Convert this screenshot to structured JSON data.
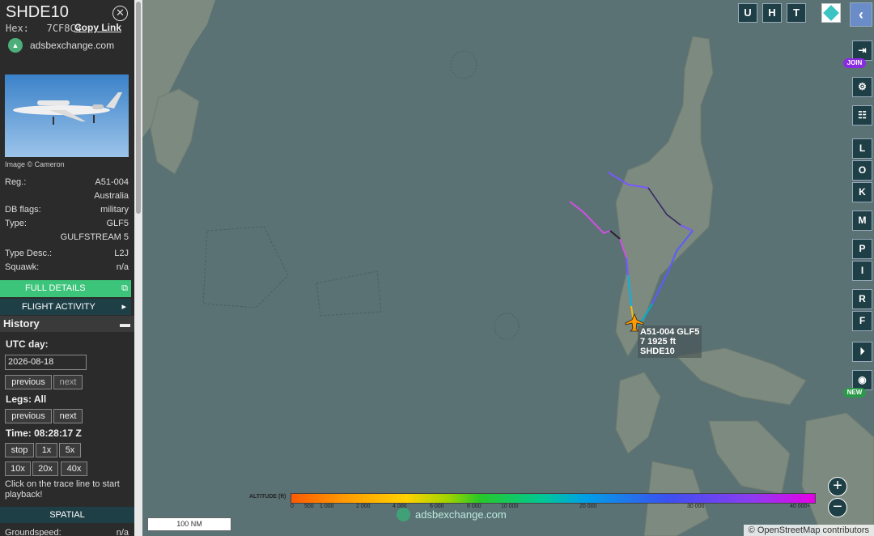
{
  "aircraft": {
    "callsign": "SHDE10",
    "hex_label": "Hex:",
    "hex": "7CF8C4",
    "copy_link": "Copy Link",
    "source": "adsbexchange.com",
    "photo_credit": "Image © Cameron",
    "details": [
      {
        "label": "Reg.:",
        "value": "A51-004"
      },
      {
        "label": "",
        "value": "Australia"
      },
      {
        "label": "DB flags:",
        "value": "military"
      },
      {
        "label": "Type:",
        "value": "GLF5"
      },
      {
        "label": "",
        "value": "GULFSTREAM 5"
      },
      {
        "label": "Type Desc.:",
        "value": "L2J"
      },
      {
        "label": "Squawk:",
        "value": "n/a"
      }
    ],
    "full_details": "FULL DETAILS",
    "flight_activity": "FLIGHT ACTIVITY"
  },
  "history": {
    "title": "History",
    "utc_label": "UTC day:",
    "date": "2026-08-18",
    "previous": "previous",
    "next": "next",
    "legs_label": "Legs: All",
    "time_label": "Time: 08:28:17 Z",
    "stop": "stop",
    "speeds": [
      "1x",
      "5x",
      "10x",
      "20x",
      "40x"
    ],
    "note": "Click on the trace line to start playback!",
    "spatial": "SPATIAL",
    "groundspeed_label": "Groundspeed:",
    "groundspeed_value": "n/a"
  },
  "map": {
    "top_buttons": [
      "U",
      "H",
      "T"
    ],
    "right_buttons": [
      "L",
      "O",
      "K",
      "M",
      "P",
      "I",
      "R",
      "F"
    ],
    "join_badge": "JOIN",
    "new_badge": "NEW",
    "scale": "100 NM",
    "watermark": "adsbexchange.com",
    "attribution": "© OpenStreetMap contributors",
    "aircraft_label": [
      "A51-004 GLF5",
      "7 1925 ft",
      "SHDE10"
    ],
    "zoom_in": "+",
    "zoom_out": "−"
  },
  "altitude_legend": {
    "label": "ALTITUDE (ft)",
    "ticks": [
      "0",
      "500",
      "1 000",
      "2 000",
      "4 000",
      "6 000",
      "8 000",
      "10 000",
      "20 000",
      "30 000",
      "40 000+"
    ]
  },
  "colors": {
    "sidebar_bg": "#2b2b2b",
    "accent_green": "#3cc47a",
    "dark_button": "#1f3f47",
    "sea": "#5b7275",
    "land": "#7d8a7f"
  }
}
